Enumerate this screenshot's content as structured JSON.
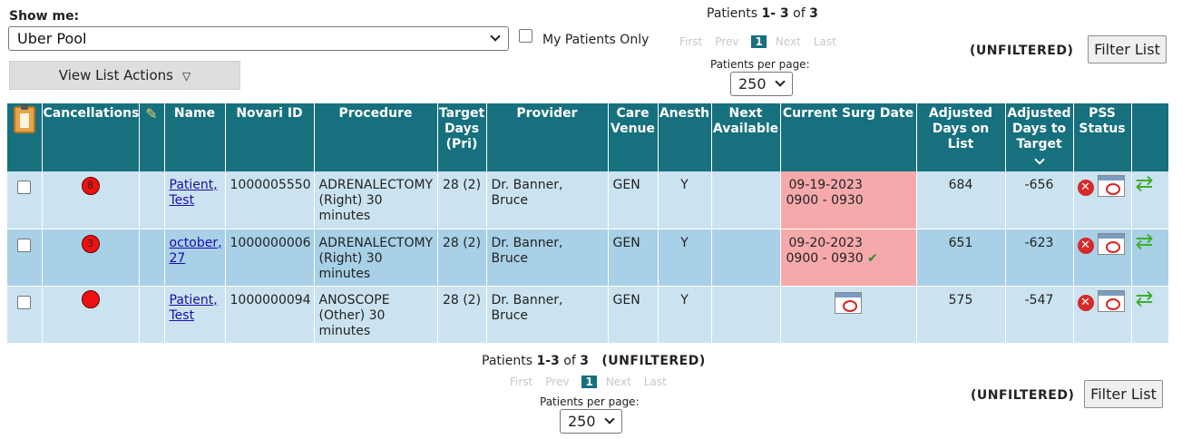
{
  "top": {
    "show_me_label": "Show me:",
    "list_selected": "Uber Pool",
    "my_patients_label": "My Patients Only",
    "view_actions_label": "View List Actions",
    "view_actions_arrow": "▽"
  },
  "pager_top": {
    "prefix": "Patients ",
    "range": "1- 3",
    "of": " of ",
    "total": "3",
    "first": "First",
    "prev": "Prev",
    "current": "1",
    "next": "Next",
    "last": "Last",
    "per_page_label": "Patients per page:",
    "per_page_value": "250"
  },
  "filter": {
    "status": "(UNFILTERED)",
    "button_label": "Filter List"
  },
  "table": {
    "headers": {
      "cancellations": "Cancellations",
      "name": "Name",
      "novari_id": "Novari ID",
      "procedure": "Procedure",
      "target_days": "Target Days (Pri)",
      "provider": "Provider",
      "care_venue": "Care Venue",
      "anesth": "Anesth",
      "next_available": "Next Available",
      "current_surg_date": "Current Surg Date",
      "adjusted_days_on_list": "Adjusted Days on List",
      "adjusted_days_to_target": "Adjusted Days to Target",
      "pss_status": "PSS Status"
    },
    "rows": [
      {
        "cancel_count": "8",
        "name_line1": "Patient,",
        "name_line2": "Test",
        "novari_id": "1000005550",
        "procedure": "ADRENALECTOMY (Right) 30 minutes",
        "target": "28 (2)",
        "provider": "Dr. Banner, Bruce",
        "venue": "GEN",
        "anesth": "Y",
        "next_available": "",
        "surg_date": "09-19-2023",
        "surg_time": "0900 - 0930",
        "days_on_list": "684",
        "days_to_target": "-656"
      },
      {
        "cancel_count": "3",
        "name_line1": "october,",
        "name_line2": "27",
        "novari_id": "1000000006",
        "procedure": "ADRENALECTOMY (Right) 30 minutes",
        "target": "28 (2)",
        "provider": "Dr. Banner, Bruce",
        "venue": "GEN",
        "anesth": "Y",
        "next_available": "",
        "surg_date": "09-20-2023",
        "surg_time": "0900 - 0930",
        "surg_check": "✔",
        "days_on_list": "651",
        "days_to_target": "-623"
      },
      {
        "cancel_count": "",
        "name_line1": "Patient,",
        "name_line2": "Test",
        "novari_id": "1000000094",
        "procedure": "ANOSCOPE (Other) 30 minutes",
        "target": "28 (2)",
        "provider": "Dr. Banner, Bruce",
        "venue": "GEN",
        "anesth": "Y",
        "next_available": "",
        "days_on_list": "575",
        "days_to_target": "-547"
      }
    ]
  },
  "pager_bottom": {
    "prefix": "Patients ",
    "range": "1-3",
    "of": " of ",
    "total": "3",
    "status": "(UNFILTERED)",
    "first": "First",
    "prev": "Prev",
    "current": "1",
    "next": "Next",
    "last": "Last",
    "per_page_label": "Patients per page:",
    "per_page_value": "250"
  },
  "colors": {
    "header_bg": "#17707e",
    "row_light": "#cbe3f0",
    "row_dark": "#a8d0e6",
    "surg_highlight": "#f6a9ab",
    "cancel_dot": "#e11111"
  },
  "icons": [
    "clipboard-icon",
    "paperclip-icon",
    "calendar-icon",
    "cancel-x-icon",
    "transfer-arrow-icon",
    "checkmark-icon",
    "chevron-down-icon"
  ]
}
